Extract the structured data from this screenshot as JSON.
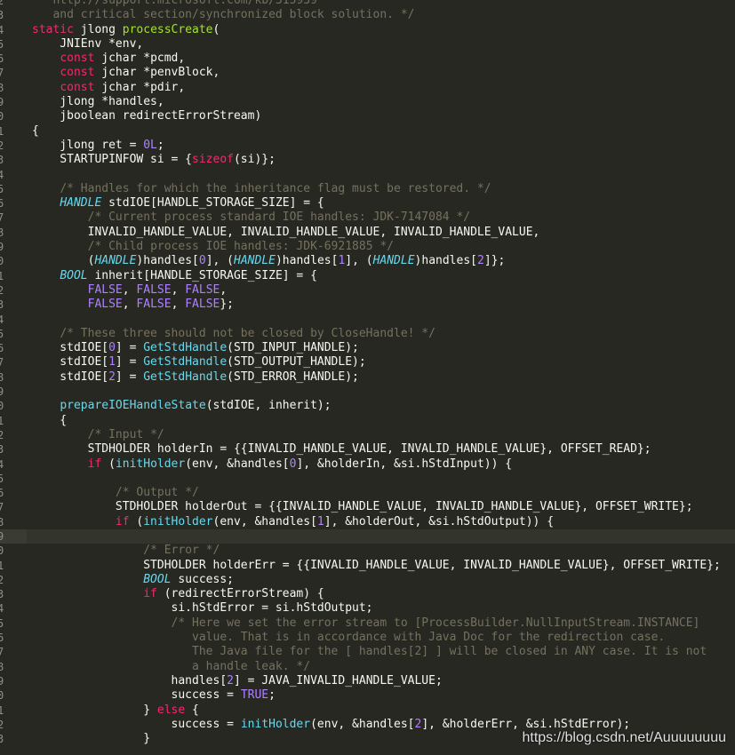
{
  "editor": {
    "lines": [
      {
        "n": "2",
        "tokens": [
          {
            "c": "comment",
            "t": "   http://support.microsoft.com/kb/315939"
          }
        ]
      },
      {
        "n": "3",
        "tokens": [
          {
            "c": "comment",
            "t": "   and critical section/synchronized block solution. */"
          }
        ]
      },
      {
        "n": "4",
        "tokens": [
          {
            "c": "kw",
            "t": "static"
          },
          {
            "c": "plain",
            "t": " jlong "
          },
          {
            "c": "fnname",
            "t": "processCreate"
          },
          {
            "c": "plain",
            "t": "("
          }
        ]
      },
      {
        "n": "5",
        "tokens": [
          {
            "c": "plain",
            "t": "    JNIEnv *env,"
          }
        ]
      },
      {
        "n": "6",
        "tokens": [
          {
            "c": "plain",
            "t": "    "
          },
          {
            "c": "kw",
            "t": "const"
          },
          {
            "c": "plain",
            "t": " jchar *pcmd,"
          }
        ]
      },
      {
        "n": "7",
        "tokens": [
          {
            "c": "plain",
            "t": "    "
          },
          {
            "c": "kw",
            "t": "const"
          },
          {
            "c": "plain",
            "t": " jchar *penvBlock,"
          }
        ]
      },
      {
        "n": "8",
        "tokens": [
          {
            "c": "plain",
            "t": "    "
          },
          {
            "c": "kw",
            "t": "const"
          },
          {
            "c": "plain",
            "t": " jchar *pdir,"
          }
        ]
      },
      {
        "n": "9",
        "tokens": [
          {
            "c": "plain",
            "t": "    jlong *handles,"
          }
        ]
      },
      {
        "n": "0",
        "tokens": [
          {
            "c": "plain",
            "t": "    jboolean redirectErrorStream)"
          }
        ]
      },
      {
        "n": "1",
        "tokens": [
          {
            "c": "plain",
            "t": "{"
          }
        ]
      },
      {
        "n": "2",
        "tokens": [
          {
            "c": "plain",
            "t": "    jlong ret = "
          },
          {
            "c": "num",
            "t": "0L"
          },
          {
            "c": "plain",
            "t": ";"
          }
        ]
      },
      {
        "n": "3",
        "tokens": [
          {
            "c": "plain",
            "t": "    STARTUPINFOW si = {"
          },
          {
            "c": "kw",
            "t": "sizeof"
          },
          {
            "c": "plain",
            "t": "(si)};"
          }
        ]
      },
      {
        "n": "4",
        "tokens": []
      },
      {
        "n": "5",
        "tokens": [
          {
            "c": "plain",
            "t": "    "
          },
          {
            "c": "comment",
            "t": "/* Handles for which the inheritance flag must be restored. */"
          }
        ]
      },
      {
        "n": "6",
        "tokens": [
          {
            "c": "plain",
            "t": "    "
          },
          {
            "c": "type",
            "t": "HANDLE"
          },
          {
            "c": "plain",
            "t": " stdIOE[HANDLE_STORAGE_SIZE] = {"
          }
        ]
      },
      {
        "n": "7",
        "tokens": [
          {
            "c": "plain",
            "t": "        "
          },
          {
            "c": "comment",
            "t": "/* Current process standard IOE handles: JDK-7147084 */"
          }
        ]
      },
      {
        "n": "8",
        "tokens": [
          {
            "c": "plain",
            "t": "        INVALID_HANDLE_VALUE, INVALID_HANDLE_VALUE, INVALID_HANDLE_VALUE,"
          }
        ]
      },
      {
        "n": "9",
        "tokens": [
          {
            "c": "plain",
            "t": "        "
          },
          {
            "c": "comment",
            "t": "/* Child process IOE handles: JDK-6921885 */"
          }
        ]
      },
      {
        "n": "0",
        "tokens": [
          {
            "c": "plain",
            "t": "        ("
          },
          {
            "c": "type",
            "t": "HANDLE"
          },
          {
            "c": "plain",
            "t": ")handles["
          },
          {
            "c": "num",
            "t": "0"
          },
          {
            "c": "plain",
            "t": "], ("
          },
          {
            "c": "type",
            "t": "HANDLE"
          },
          {
            "c": "plain",
            "t": ")handles["
          },
          {
            "c": "num",
            "t": "1"
          },
          {
            "c": "plain",
            "t": "], ("
          },
          {
            "c": "type",
            "t": "HANDLE"
          },
          {
            "c": "plain",
            "t": ")handles["
          },
          {
            "c": "num",
            "t": "2"
          },
          {
            "c": "plain",
            "t": "]};"
          }
        ]
      },
      {
        "n": "1",
        "tokens": [
          {
            "c": "plain",
            "t": "    "
          },
          {
            "c": "type",
            "t": "BOOL"
          },
          {
            "c": "plain",
            "t": " inherit[HANDLE_STORAGE_SIZE] = {"
          }
        ]
      },
      {
        "n": "2",
        "tokens": [
          {
            "c": "plain",
            "t": "        "
          },
          {
            "c": "const",
            "t": "FALSE"
          },
          {
            "c": "plain",
            "t": ", "
          },
          {
            "c": "const",
            "t": "FALSE"
          },
          {
            "c": "plain",
            "t": ", "
          },
          {
            "c": "const",
            "t": "FALSE"
          },
          {
            "c": "plain",
            "t": ","
          }
        ]
      },
      {
        "n": "3",
        "tokens": [
          {
            "c": "plain",
            "t": "        "
          },
          {
            "c": "const",
            "t": "FALSE"
          },
          {
            "c": "plain",
            "t": ", "
          },
          {
            "c": "const",
            "t": "FALSE"
          },
          {
            "c": "plain",
            "t": ", "
          },
          {
            "c": "const",
            "t": "FALSE"
          },
          {
            "c": "plain",
            "t": "};"
          }
        ]
      },
      {
        "n": "4",
        "tokens": []
      },
      {
        "n": "5",
        "tokens": [
          {
            "c": "plain",
            "t": "    "
          },
          {
            "c": "comment",
            "t": "/* These three should not be closed by CloseHandle! */"
          }
        ]
      },
      {
        "n": "6",
        "tokens": [
          {
            "c": "plain",
            "t": "    stdIOE["
          },
          {
            "c": "num",
            "t": "0"
          },
          {
            "c": "plain",
            "t": "] = "
          },
          {
            "c": "call",
            "t": "GetStdHandle"
          },
          {
            "c": "plain",
            "t": "(STD_INPUT_HANDLE);"
          }
        ]
      },
      {
        "n": "7",
        "tokens": [
          {
            "c": "plain",
            "t": "    stdIOE["
          },
          {
            "c": "num",
            "t": "1"
          },
          {
            "c": "plain",
            "t": "] = "
          },
          {
            "c": "call",
            "t": "GetStdHandle"
          },
          {
            "c": "plain",
            "t": "(STD_OUTPUT_HANDLE);"
          }
        ]
      },
      {
        "n": "8",
        "tokens": [
          {
            "c": "plain",
            "t": "    stdIOE["
          },
          {
            "c": "num",
            "t": "2"
          },
          {
            "c": "plain",
            "t": "] = "
          },
          {
            "c": "call",
            "t": "GetStdHandle"
          },
          {
            "c": "plain",
            "t": "(STD_ERROR_HANDLE);"
          }
        ]
      },
      {
        "n": "9",
        "tokens": []
      },
      {
        "n": "0",
        "tokens": [
          {
            "c": "plain",
            "t": "    "
          },
          {
            "c": "call",
            "t": "prepareIOEHandleState"
          },
          {
            "c": "plain",
            "t": "(stdIOE, inherit);"
          }
        ]
      },
      {
        "n": "1",
        "tokens": [
          {
            "c": "plain",
            "t": "    {"
          }
        ]
      },
      {
        "n": "2",
        "tokens": [
          {
            "c": "plain",
            "t": "        "
          },
          {
            "c": "comment",
            "t": "/* Input */"
          }
        ]
      },
      {
        "n": "3",
        "tokens": [
          {
            "c": "plain",
            "t": "        STDHOLDER holderIn = {{INVALID_HANDLE_VALUE, INVALID_HANDLE_VALUE}, OFFSET_READ};"
          }
        ]
      },
      {
        "n": "4",
        "tokens": [
          {
            "c": "plain",
            "t": "        "
          },
          {
            "c": "kw",
            "t": "if"
          },
          {
            "c": "plain",
            "t": " ("
          },
          {
            "c": "call",
            "t": "initHolder"
          },
          {
            "c": "plain",
            "t": "(env, &handles["
          },
          {
            "c": "num",
            "t": "0"
          },
          {
            "c": "plain",
            "t": "], &holderIn, &si.hStdInput)) {"
          }
        ]
      },
      {
        "n": "5",
        "tokens": []
      },
      {
        "n": "6",
        "tokens": [
          {
            "c": "plain",
            "t": "            "
          },
          {
            "c": "comment",
            "t": "/* Output */"
          }
        ]
      },
      {
        "n": "7",
        "tokens": [
          {
            "c": "plain",
            "t": "            STDHOLDER holderOut = {{INVALID_HANDLE_VALUE, INVALID_HANDLE_VALUE}, OFFSET_WRITE};"
          }
        ]
      },
      {
        "n": "8",
        "tokens": [
          {
            "c": "plain",
            "t": "            "
          },
          {
            "c": "kw",
            "t": "if"
          },
          {
            "c": "plain",
            "t": " ("
          },
          {
            "c": "call",
            "t": "initHolder"
          },
          {
            "c": "plain",
            "t": "(env, &handles["
          },
          {
            "c": "num",
            "t": "1"
          },
          {
            "c": "plain",
            "t": "], &holderOut, &si.hStdOutput)) {"
          }
        ]
      },
      {
        "n": "9",
        "hl": true,
        "tokens": []
      },
      {
        "n": "0",
        "tokens": [
          {
            "c": "plain",
            "t": "                "
          },
          {
            "c": "comment",
            "t": "/* Error */"
          }
        ]
      },
      {
        "n": "1",
        "tokens": [
          {
            "c": "plain",
            "t": "                STDHOLDER holderErr = {{INVALID_HANDLE_VALUE, INVALID_HANDLE_VALUE}, OFFSET_WRITE};"
          }
        ]
      },
      {
        "n": "2",
        "tokens": [
          {
            "c": "plain",
            "t": "                "
          },
          {
            "c": "type",
            "t": "BOOL"
          },
          {
            "c": "plain",
            "t": " success;"
          }
        ]
      },
      {
        "n": "3",
        "tokens": [
          {
            "c": "plain",
            "t": "                "
          },
          {
            "c": "kw",
            "t": "if"
          },
          {
            "c": "plain",
            "t": " (redirectErrorStream) {"
          }
        ]
      },
      {
        "n": "4",
        "tokens": [
          {
            "c": "plain",
            "t": "                    si.hStdError = si.hStdOutput;"
          }
        ]
      },
      {
        "n": "5",
        "tokens": [
          {
            "c": "plain",
            "t": "                    "
          },
          {
            "c": "comment",
            "t": "/* Here we set the error stream to [ProcessBuilder.NullInputStream.INSTANCE]"
          }
        ]
      },
      {
        "n": "6",
        "tokens": [
          {
            "c": "comment",
            "t": "                       value. That is in accordance with Java Doc for the redirection case."
          }
        ]
      },
      {
        "n": "7",
        "tokens": [
          {
            "c": "comment",
            "t": "                       The Java file for the [ handles[2] ] will be closed in ANY case. It is not"
          }
        ]
      },
      {
        "n": "8",
        "tokens": [
          {
            "c": "comment",
            "t": "                       a handle leak. */"
          }
        ]
      },
      {
        "n": "9",
        "tokens": [
          {
            "c": "plain",
            "t": "                    handles["
          },
          {
            "c": "num",
            "t": "2"
          },
          {
            "c": "plain",
            "t": "] = JAVA_INVALID_HANDLE_VALUE;"
          }
        ]
      },
      {
        "n": "0",
        "tokens": [
          {
            "c": "plain",
            "t": "                    success = "
          },
          {
            "c": "const",
            "t": "TRUE"
          },
          {
            "c": "plain",
            "t": ";"
          }
        ]
      },
      {
        "n": "1",
        "tokens": [
          {
            "c": "plain",
            "t": "                } "
          },
          {
            "c": "kw",
            "t": "else"
          },
          {
            "c": "plain",
            "t": " {"
          }
        ]
      },
      {
        "n": "2",
        "tokens": [
          {
            "c": "plain",
            "t": "                    success = "
          },
          {
            "c": "call",
            "t": "initHolder"
          },
          {
            "c": "plain",
            "t": "(env, &handles["
          },
          {
            "c": "num",
            "t": "2"
          },
          {
            "c": "plain",
            "t": "], &holderErr, &si.hStdError);"
          }
        ]
      },
      {
        "n": "3",
        "tokens": [
          {
            "c": "plain",
            "t": "                }"
          }
        ]
      }
    ]
  },
  "watermark": "https://blog.csdn.net/Auuuuuuuu"
}
